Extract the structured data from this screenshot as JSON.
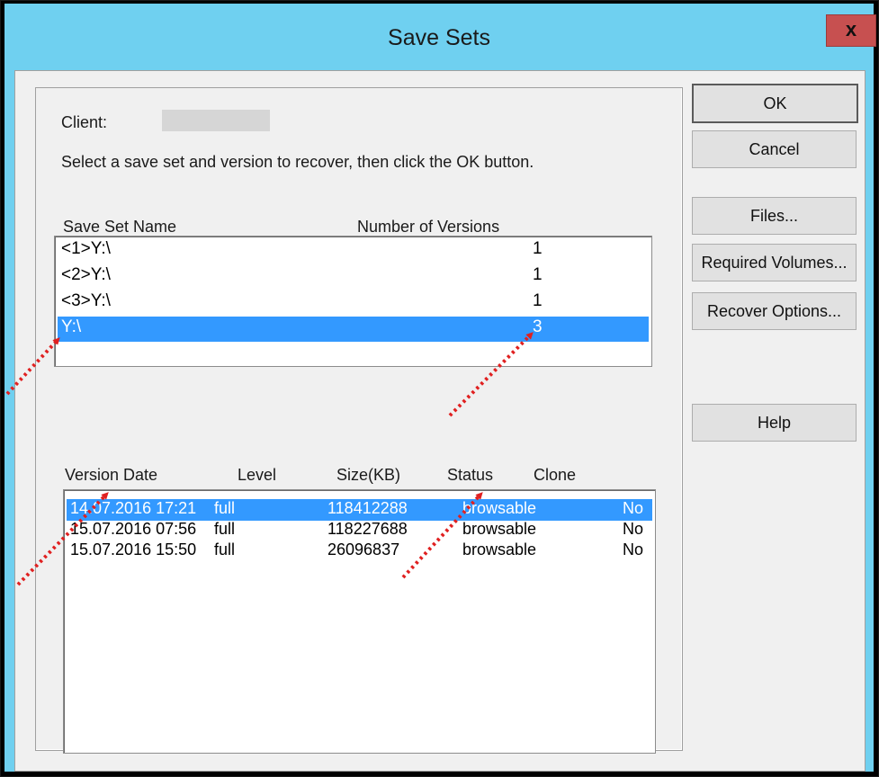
{
  "window": {
    "title": "Save Sets",
    "close_glyph": "x"
  },
  "client": {
    "label": "Client:",
    "instruction": "Select a save set and version to recover, then click the OK button."
  },
  "saveset_list": {
    "headers": {
      "name": "Save Set Name",
      "versions": "Number of Versions"
    },
    "rows": [
      {
        "name": "<1>Y:\\",
        "versions": "1",
        "selected": false
      },
      {
        "name": "<2>Y:\\",
        "versions": "1",
        "selected": false
      },
      {
        "name": "<3>Y:\\",
        "versions": "1",
        "selected": false
      },
      {
        "name": "Y:\\",
        "versions": "3",
        "selected": true
      }
    ]
  },
  "version_list": {
    "headers": {
      "date": "Version Date",
      "level": "Level",
      "size": "Size(KB)",
      "status": "Status",
      "clone": "Clone"
    },
    "rows": [
      {
        "date": "14.07.2016 17:21",
        "level": "full",
        "size": "118412288",
        "status": "browsable",
        "clone": "No",
        "selected": true
      },
      {
        "date": "15.07.2016 07:56",
        "level": "full",
        "size": "118227688",
        "status": "browsable",
        "clone": "No",
        "selected": false
      },
      {
        "date": "15.07.2016 15:50",
        "level": "full",
        "size": "26096837",
        "status": "browsable",
        "clone": "No",
        "selected": false
      }
    ]
  },
  "buttons": {
    "ok": "OK",
    "cancel": "Cancel",
    "files": "Files...",
    "required_volumes": "Required Volumes...",
    "recover_options": "Recover Options...",
    "help": "Help"
  },
  "colors": {
    "title_bar": "#6fd0f0",
    "selection": "#3399ff",
    "close_button": "#c75050",
    "annotation_arrow": "#e02020"
  }
}
